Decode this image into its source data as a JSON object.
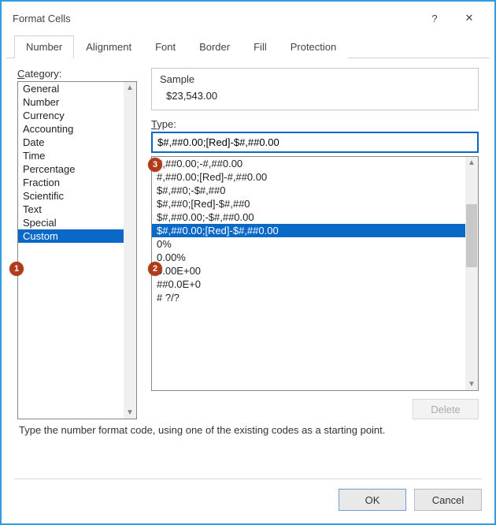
{
  "title": "Format Cells",
  "titlebar": {
    "help": "?",
    "close": "✕"
  },
  "tabs": [
    "Number",
    "Alignment",
    "Font",
    "Border",
    "Fill",
    "Protection"
  ],
  "activeTab": 0,
  "category_label": "Category:",
  "categories": [
    "General",
    "Number",
    "Currency",
    "Accounting",
    "Date",
    "Time",
    "Percentage",
    "Fraction",
    "Scientific",
    "Text",
    "Special",
    "Custom"
  ],
  "selectedCategory": 11,
  "sample_label": "Sample",
  "sample_value": "$23,543.00",
  "type_label": "Type:",
  "type_value": "$#,##0.00;[Red]-$#,##0.00",
  "type_options": [
    "#,##0.00;-#,##0.00",
    "#,##0.00;[Red]-#,##0.00",
    "$#,##0;-$#,##0",
    "$#,##0;[Red]-$#,##0",
    "$#,##0.00;-$#,##0.00",
    "$#,##0.00;[Red]-$#,##0.00",
    "0%",
    "0.00%",
    "0.00E+00",
    "##0.0E+0",
    "# ?/?"
  ],
  "selectedTypeOption": 5,
  "delete_label": "Delete",
  "hint": "Type the number format code, using one of the existing codes as a starting point.",
  "ok_label": "OK",
  "cancel_label": "Cancel",
  "callouts": {
    "c1": "1",
    "c2": "2",
    "c3": "3"
  }
}
